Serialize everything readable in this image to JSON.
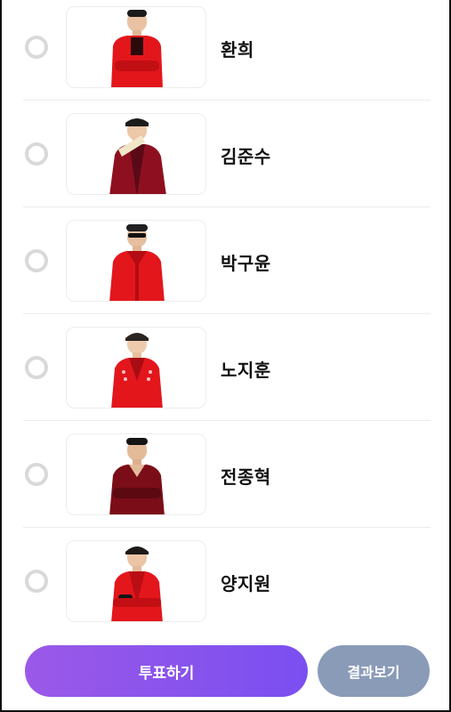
{
  "colors": {
    "vote_gradient_start": "#9b59e8",
    "vote_gradient_end": "#7a4ff0",
    "result_button": "#8a9bb8",
    "radio_border": "#d9d9d9",
    "outfit_red": "#e3161c",
    "outfit_dark_red": "#8e1020"
  },
  "candidates": [
    {
      "name": "환희",
      "photo": "person-red-jacket-arms-crossed",
      "selected": false
    },
    {
      "name": "김준수",
      "photo": "person-maroon-cape-fan",
      "selected": false
    },
    {
      "name": "박구윤",
      "photo": "person-red-leather-jacket-sunglasses",
      "selected": false
    },
    {
      "name": "노지훈",
      "photo": "person-red-embellished-jacket",
      "selected": false
    },
    {
      "name": "전종혁",
      "photo": "person-dark-red-shirt-arms-crossed",
      "selected": false
    },
    {
      "name": "양지원",
      "photo": "person-red-jacket-gloves",
      "selected": false
    }
  ],
  "footer": {
    "vote_label": "투표하기",
    "result_label": "결과보기"
  }
}
